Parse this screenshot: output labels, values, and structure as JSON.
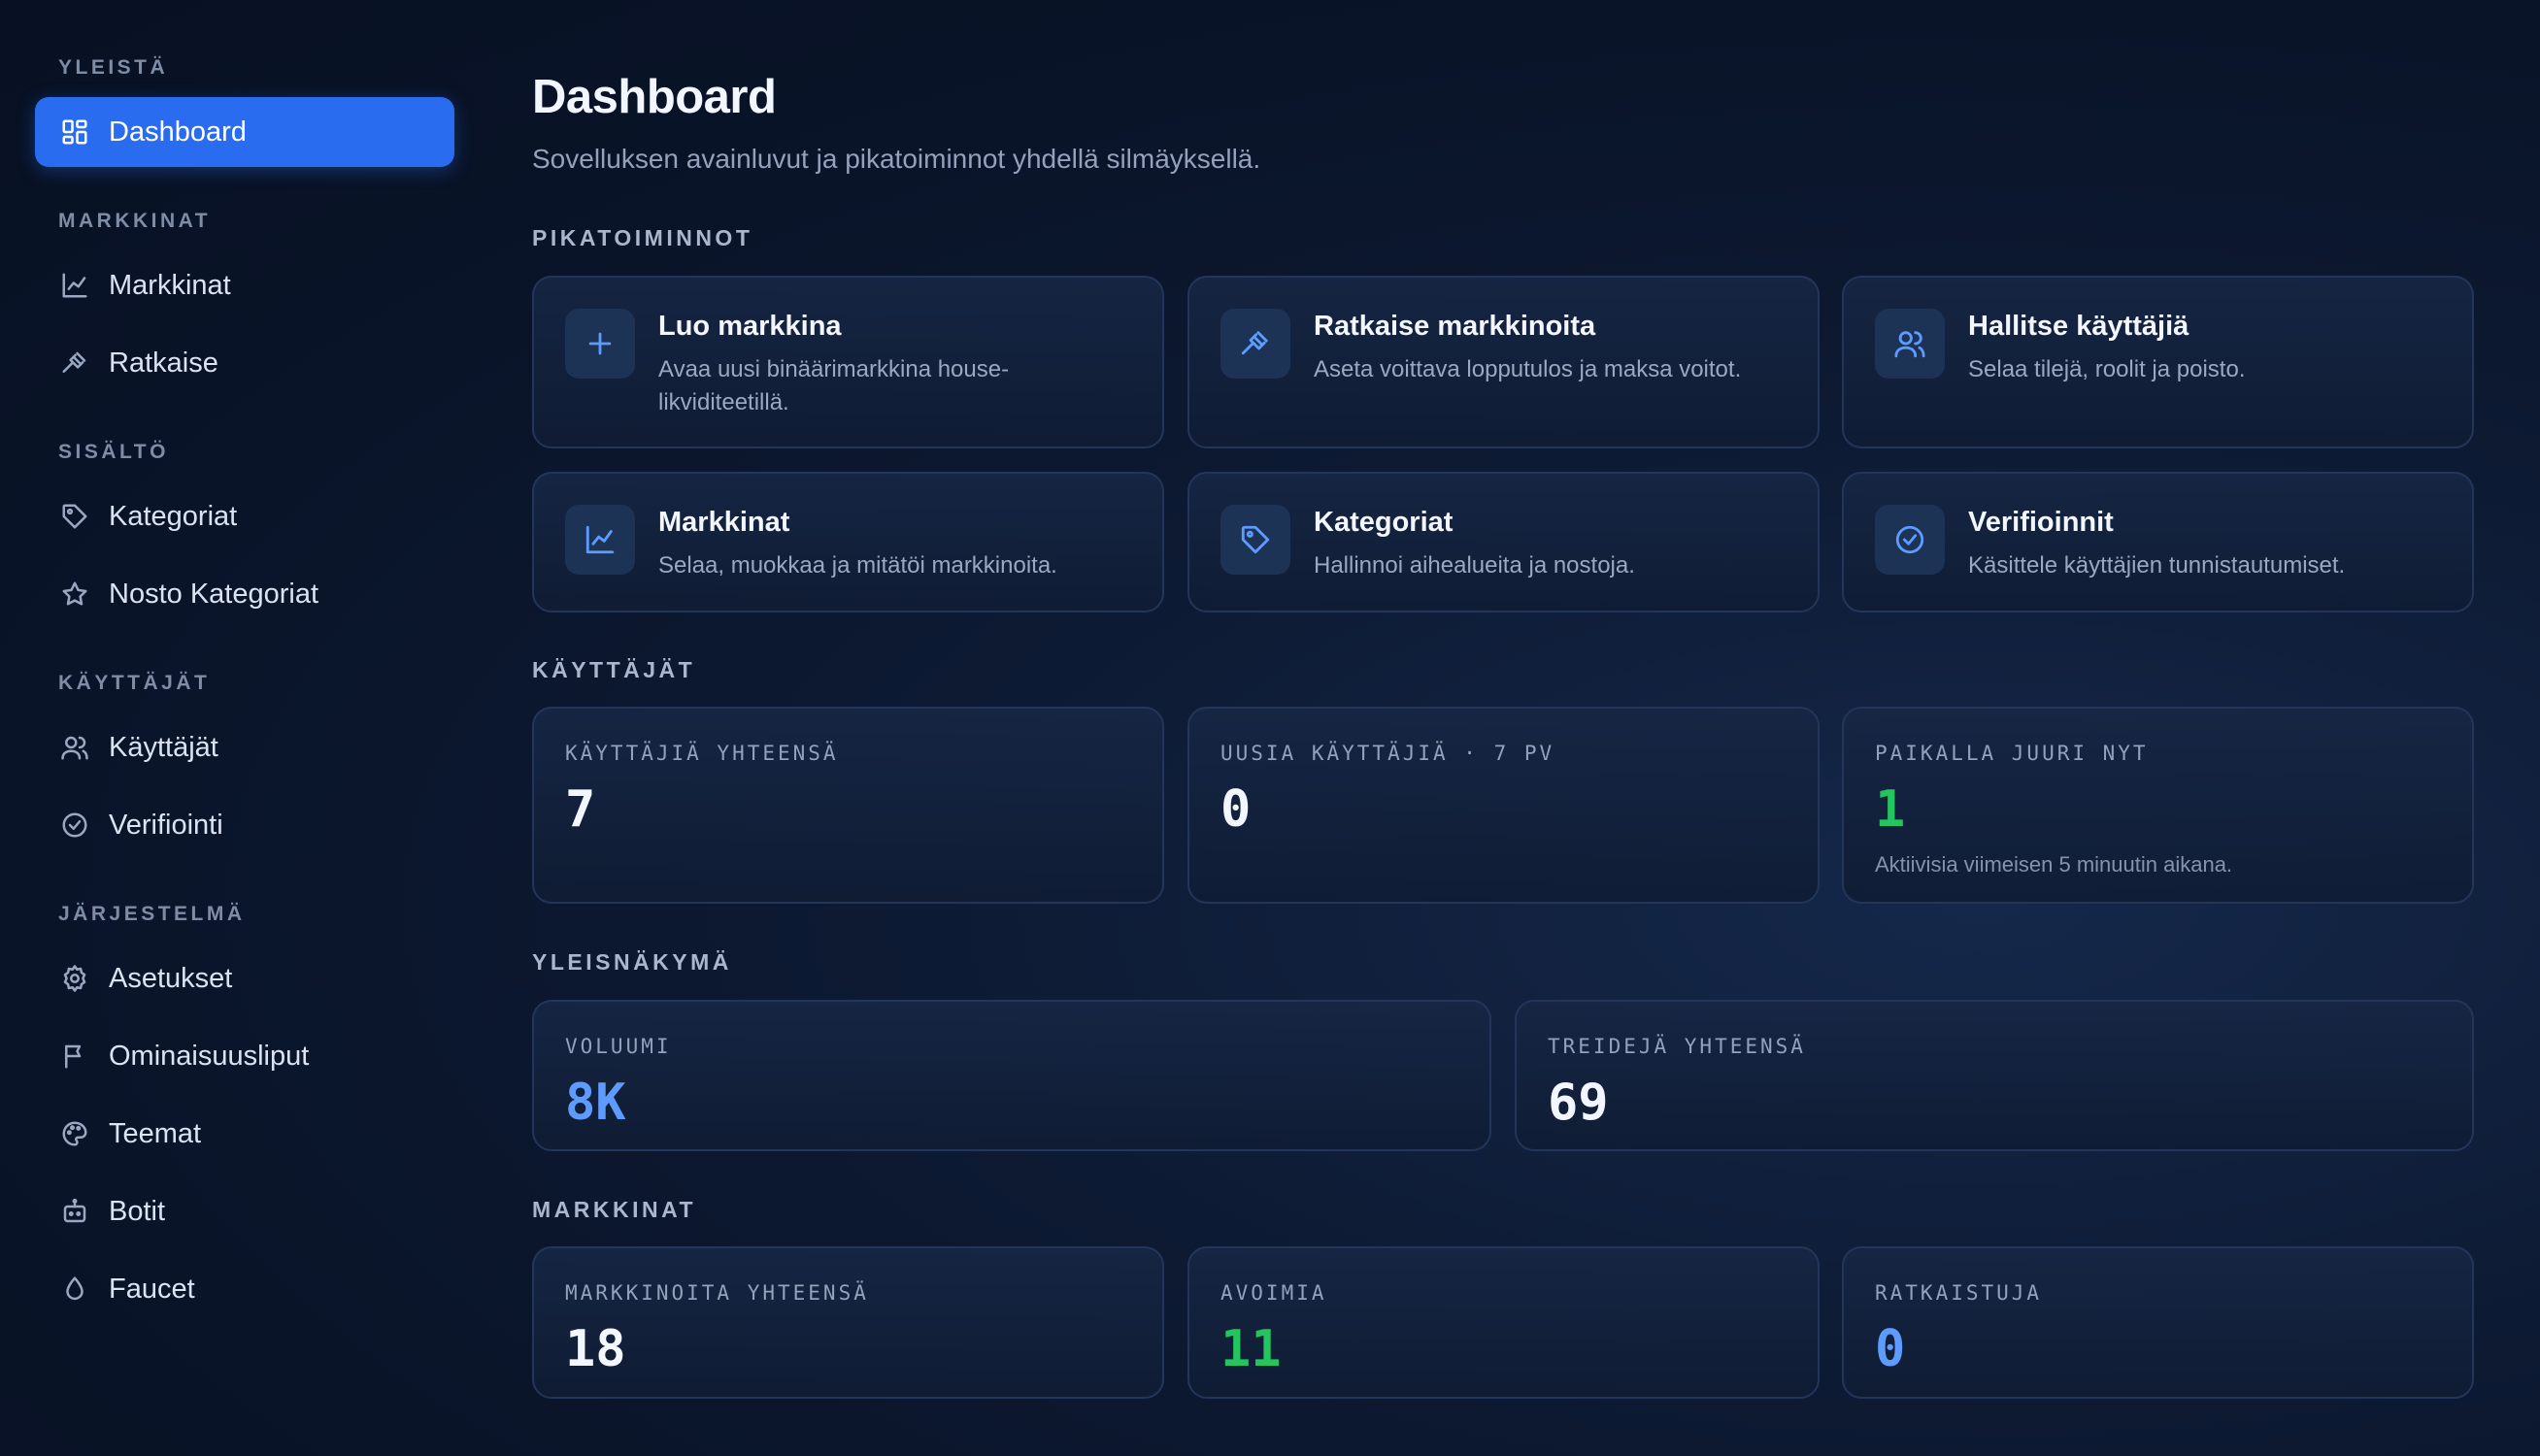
{
  "sidebar": {
    "sections": [
      {
        "title": "YLEISTÄ",
        "items": [
          {
            "label": "Dashboard",
            "icon": "dashboard-icon",
            "active": true
          }
        ]
      },
      {
        "title": "MARKKINAT",
        "items": [
          {
            "label": "Markkinat",
            "icon": "line-chart-icon"
          },
          {
            "label": "Ratkaise",
            "icon": "gavel-icon"
          }
        ]
      },
      {
        "title": "SISÄLTÖ",
        "items": [
          {
            "label": "Kategoriat",
            "icon": "tag-icon"
          },
          {
            "label": "Nosto Kategoriat",
            "icon": "star-icon"
          }
        ]
      },
      {
        "title": "KÄYTTÄJÄT",
        "items": [
          {
            "label": "Käyttäjät",
            "icon": "users-icon"
          },
          {
            "label": "Verifiointi",
            "icon": "badge-check-icon"
          }
        ]
      },
      {
        "title": "JÄRJESTELMÄ",
        "items": [
          {
            "label": "Asetukset",
            "icon": "gear-icon"
          },
          {
            "label": "Ominaisuusliput",
            "icon": "flag-icon"
          },
          {
            "label": "Teemat",
            "icon": "palette-icon"
          },
          {
            "label": "Botit",
            "icon": "bot-icon"
          },
          {
            "label": "Faucet",
            "icon": "droplet-icon"
          }
        ]
      }
    ]
  },
  "header": {
    "title": "Dashboard",
    "subtitle": "Sovelluksen avainluvut ja pikatoiminnot yhdellä silmäyksellä."
  },
  "quick_actions": {
    "title": "PIKATOIMINNOT",
    "items": [
      {
        "title": "Luo markkina",
        "desc": "Avaa uusi binäärimarkkina house-likviditeetillä.",
        "icon": "plus-icon"
      },
      {
        "title": "Ratkaise markkinoita",
        "desc": "Aseta voittava lopputulos ja maksa voitot.",
        "icon": "gavel-icon"
      },
      {
        "title": "Hallitse käyttäjiä",
        "desc": "Selaa tilejä, roolit ja poisto.",
        "icon": "users-icon"
      },
      {
        "title": "Markkinat",
        "desc": "Selaa, muokkaa ja mitätöi markkinoita.",
        "icon": "line-chart-icon"
      },
      {
        "title": "Kategoriat",
        "desc": "Hallinnoi aihealueita ja nostoja.",
        "icon": "tag-icon"
      },
      {
        "title": "Verifioinnit",
        "desc": "Käsittele käyttäjien tunnistautumiset.",
        "icon": "badge-check-icon"
      }
    ]
  },
  "users": {
    "title": "KÄYTTÄJÄT",
    "stats": [
      {
        "label": "KÄYTTÄJIÄ YHTEENSÄ",
        "value": "7",
        "note": ""
      },
      {
        "label": "UUSIA KÄYTTÄJIÄ · 7 PV",
        "value": "0",
        "note": ""
      },
      {
        "label": "PAIKALLA JUURI NYT",
        "value": "1",
        "note": "Aktiivisia viimeisen 5 minuutin aikana."
      }
    ]
  },
  "overview": {
    "title": "YLEISNÄKYMÄ",
    "stats": [
      {
        "label": "VOLUUMI",
        "value": "8K"
      },
      {
        "label": "TREIDEJÄ YHTEENSÄ",
        "value": "69"
      }
    ]
  },
  "markets": {
    "title": "MARKKINAT",
    "stats": [
      {
        "label": "MARKKINOITA YHTEENSÄ",
        "value": "18"
      },
      {
        "label": "AVOIMIA",
        "value": "11"
      },
      {
        "label": "RATKAISTUJA",
        "value": "0"
      }
    ]
  },
  "colors": {
    "accent": "#2a6cf0",
    "value_green": "#22c55e",
    "value_blue": "#5e9bff",
    "value_white": "#f2f6ff"
  }
}
